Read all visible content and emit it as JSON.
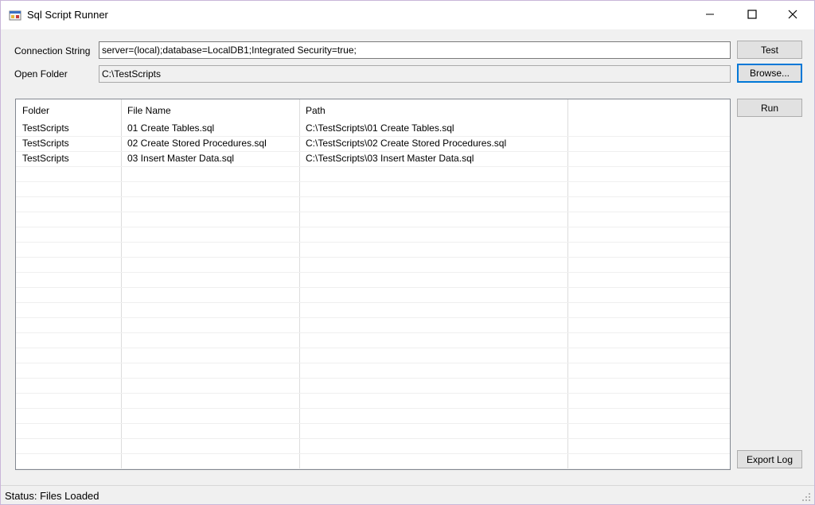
{
  "window": {
    "title": "Sql Script Runner",
    "app_icon": "sql-runner-app-icon",
    "controls": [
      "minimize-icon",
      "maximize-icon",
      "close-icon"
    ]
  },
  "form": {
    "connection_label": "Connection String",
    "connection_value": "server=(local);database=LocalDB1;Integrated Security=true;",
    "folder_label": "Open Folder",
    "folder_value": "C:\\TestScripts"
  },
  "buttons": {
    "test": "Test",
    "browse": "Browse...",
    "run": "Run",
    "export_log": "Export Log"
  },
  "grid": {
    "columns": [
      "Folder",
      "File Name",
      "Path"
    ],
    "rows": [
      [
        "TestScripts",
        "01 Create Tables.sql",
        "C:\\TestScripts\\01 Create Tables.sql"
      ],
      [
        "TestScripts",
        "02 Create Stored Procedures.sql",
        "C:\\TestScripts\\02 Create Stored Procedures.sql"
      ],
      [
        "TestScripts",
        "03 Insert Master Data.sql",
        "C:\\TestScripts\\03 Insert Master Data.sql"
      ]
    ]
  },
  "status": {
    "text": "Status: Files Loaded"
  },
  "colors": {
    "focus_border": "#0078d7",
    "window_border": "#c9b6d9",
    "form_background": "#f0f0f0"
  }
}
